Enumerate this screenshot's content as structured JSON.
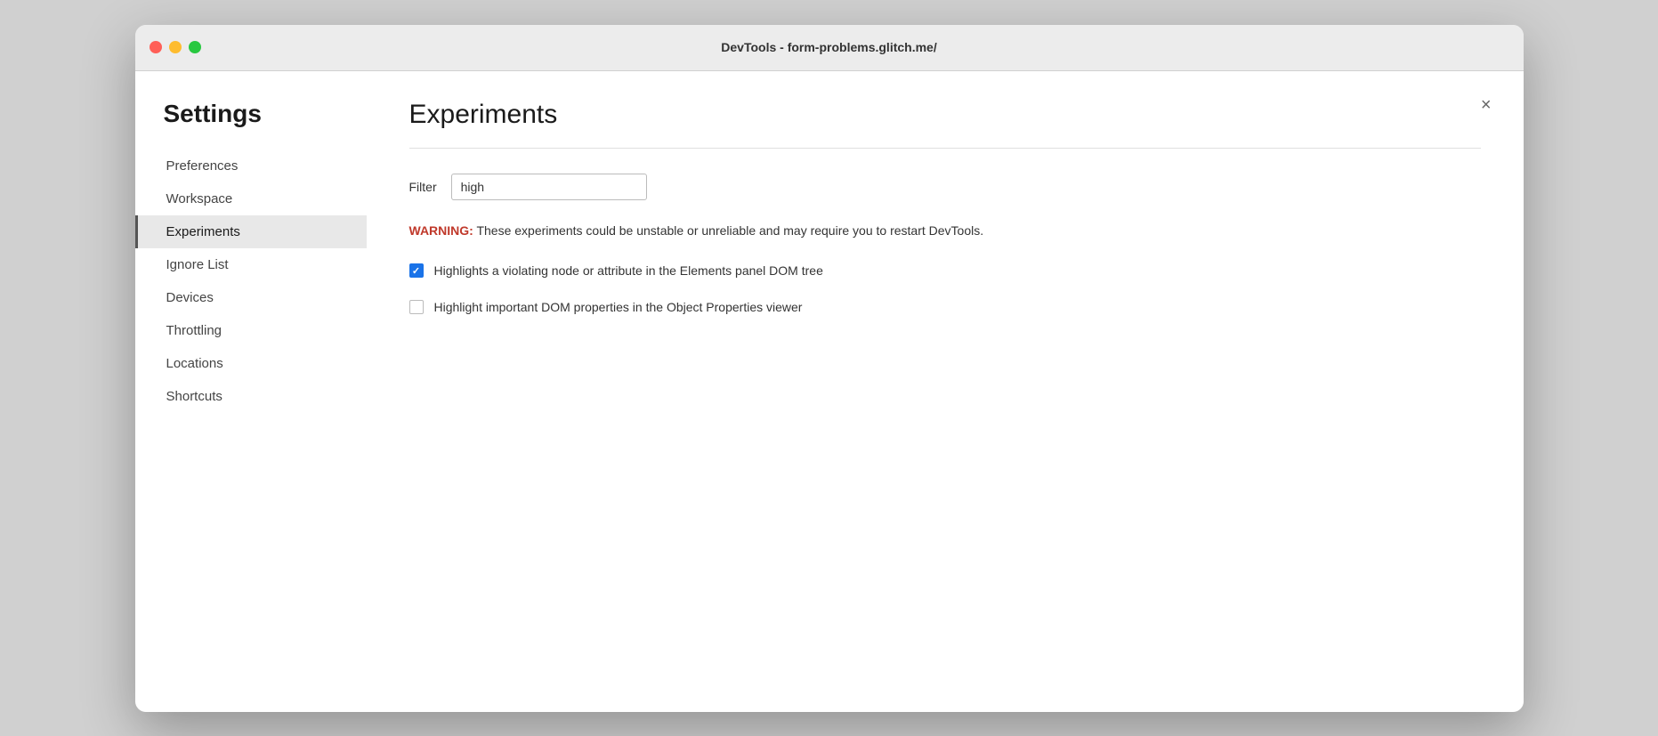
{
  "window": {
    "title": "DevTools - form-problems.glitch.me/"
  },
  "sidebar": {
    "heading": "Settings",
    "items": [
      {
        "id": "preferences",
        "label": "Preferences",
        "active": false
      },
      {
        "id": "workspace",
        "label": "Workspace",
        "active": false
      },
      {
        "id": "experiments",
        "label": "Experiments",
        "active": true
      },
      {
        "id": "ignore-list",
        "label": "Ignore List",
        "active": false
      },
      {
        "id": "devices",
        "label": "Devices",
        "active": false
      },
      {
        "id": "throttling",
        "label": "Throttling",
        "active": false
      },
      {
        "id": "locations",
        "label": "Locations",
        "active": false
      },
      {
        "id": "shortcuts",
        "label": "Shortcuts",
        "active": false
      }
    ]
  },
  "main": {
    "page_title": "Experiments",
    "filter_label": "Filter",
    "filter_value": "high",
    "filter_placeholder": "",
    "warning_label": "WARNING:",
    "warning_text": "These experiments could be unstable or unreliable and may require you to restart DevTools.",
    "experiments": [
      {
        "id": "exp1",
        "label": "Highlights a violating node or attribute in the Elements panel DOM tree",
        "checked": true
      },
      {
        "id": "exp2",
        "label": "Highlight important DOM properties in the Object Properties viewer",
        "checked": false
      }
    ],
    "close_button": "×"
  },
  "traffic_lights": {
    "close_color": "#ff5f57",
    "minimize_color": "#febc2e",
    "maximize_color": "#28c840"
  }
}
